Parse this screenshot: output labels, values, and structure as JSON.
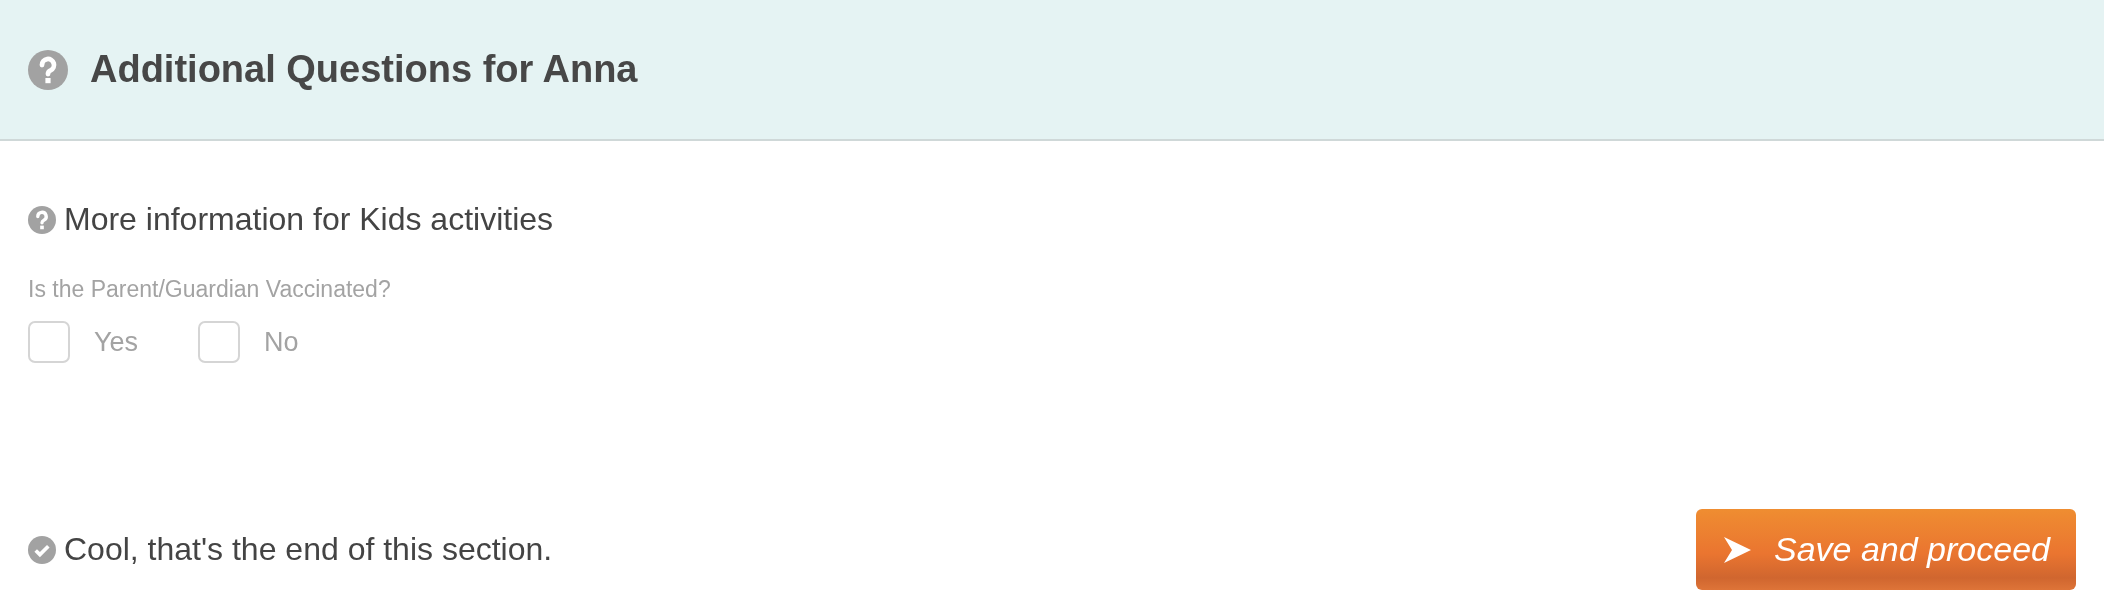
{
  "header": {
    "title": "Additional Questions for Anna"
  },
  "section": {
    "title": "More information for Kids activities"
  },
  "question": {
    "label": "Is the Parent/Guardian Vaccinated?",
    "options": [
      {
        "label": "Yes",
        "checked": false
      },
      {
        "label": "No",
        "checked": false
      }
    ]
  },
  "footer": {
    "message": "Cool, that's the end of this section.",
    "button": "Save and proceed"
  }
}
